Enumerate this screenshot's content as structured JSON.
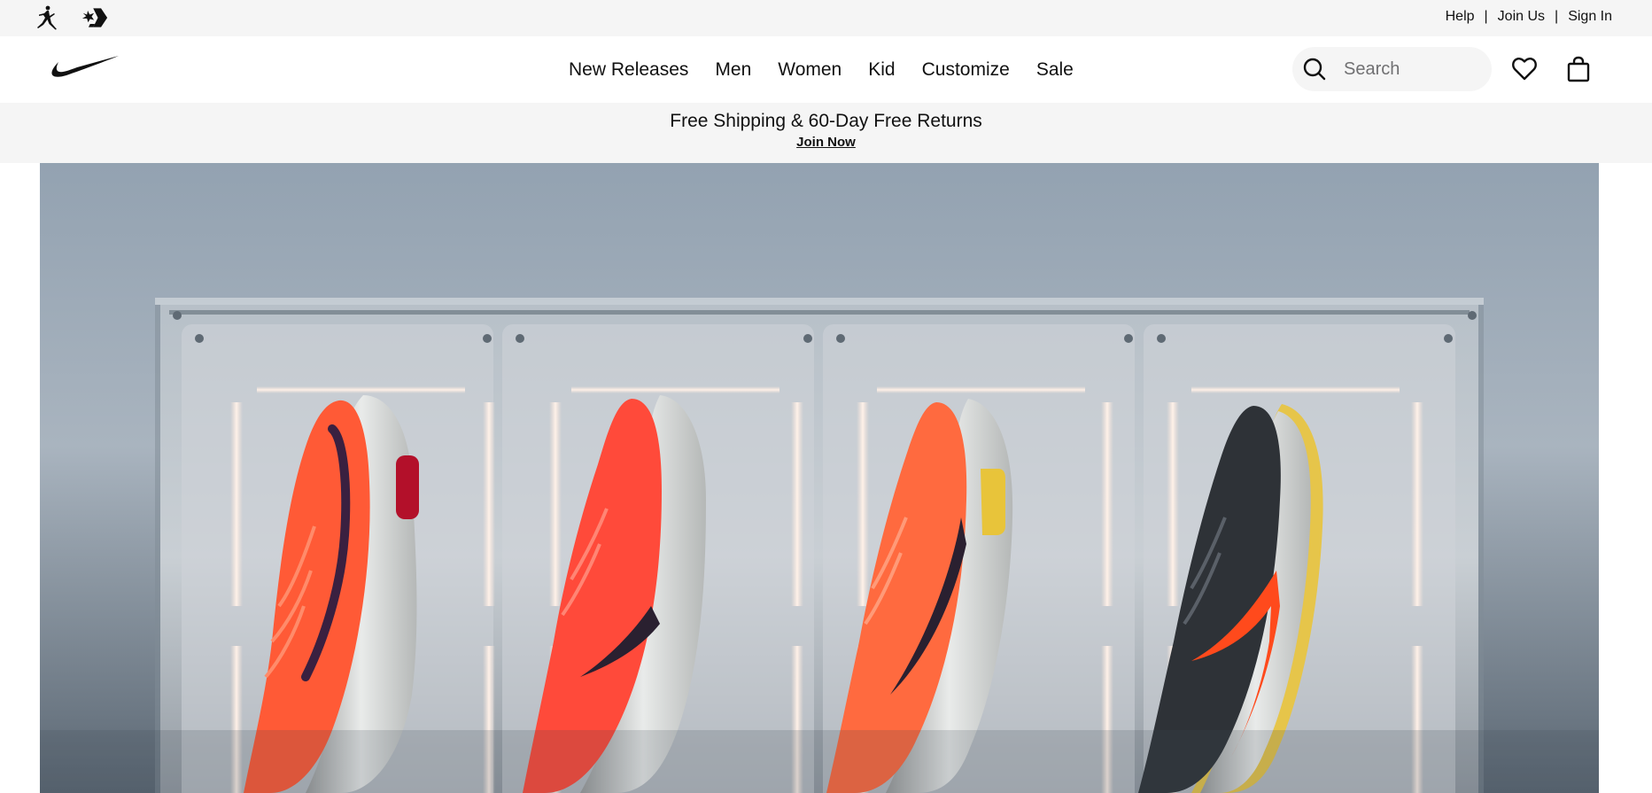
{
  "utility_bar": {
    "brands": [
      {
        "name": "jordan-logo-icon",
        "label": "Jordan"
      },
      {
        "name": "converse-logo-icon",
        "label": "Converse"
      }
    ],
    "links": {
      "help": "Help",
      "join_us": "Join Us",
      "sign_in": "Sign In",
      "separator": "|"
    }
  },
  "header": {
    "logo_icon": "nike-swoosh-icon",
    "nav": [
      "New Releases",
      "Men",
      "Women",
      "Kid",
      "Customize",
      "Sale"
    ],
    "search": {
      "placeholder": "Search",
      "value": "",
      "icon": "search-icon"
    },
    "favorites_icon": "heart-icon",
    "bag_icon": "shopping-bag-icon"
  },
  "promo": {
    "title": "Free Shipping & 60-Day Free Returns",
    "link": "Join Now"
  },
  "hero": {
    "image": "four-running-shoes-in-display-case",
    "shoe_colors": [
      "#ff5a36",
      "#ff4a3a",
      "#ff6a3f",
      "#2e3237"
    ],
    "accent_colors": {
      "background": "#8e9dab",
      "swoosh_dark": "#2a2030",
      "swoosh_orange": "#ff4a1c",
      "sole_yellow": "#e8c43a"
    }
  },
  "colors": {
    "bar_background": "#f5f5f5",
    "text": "#111111",
    "placeholder": "#707072"
  }
}
